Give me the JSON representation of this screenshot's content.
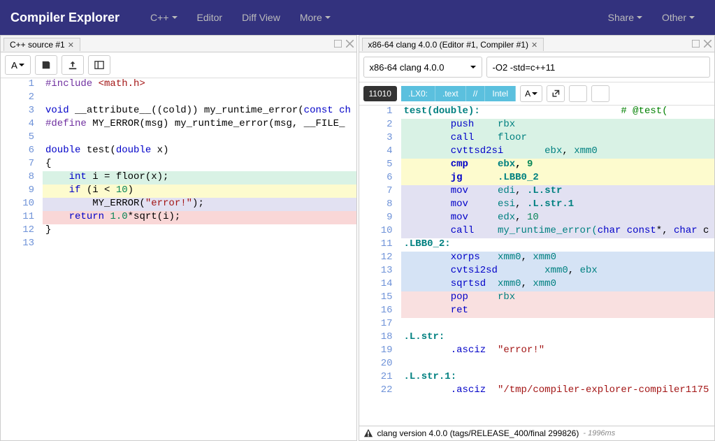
{
  "navbar": {
    "brand": "Compiler Explorer",
    "items": [
      "C++",
      "Editor",
      "Diff View",
      "More"
    ],
    "right": [
      "Share",
      "Other"
    ]
  },
  "left": {
    "tab": "C++ source #1",
    "fontBtn": "A",
    "lines": [
      {
        "n": 1,
        "bg": "",
        "tokens": [
          {
            "t": "#include ",
            "c": "mac"
          },
          {
            "t": "<math.h>",
            "c": "str"
          }
        ]
      },
      {
        "n": 2,
        "bg": "",
        "tokens": []
      },
      {
        "n": 3,
        "bg": "",
        "tokens": [
          {
            "t": "void",
            "c": "kw"
          },
          {
            "t": " __attribute__((",
            "c": ""
          },
          {
            "t": "cold",
            "c": ""
          },
          {
            "t": ")) my_runtime_error(",
            "c": ""
          },
          {
            "t": "const",
            "c": "kw"
          },
          {
            "t": " ",
            "c": ""
          },
          {
            "t": "ch",
            "c": "kw"
          }
        ]
      },
      {
        "n": 4,
        "bg": "",
        "tokens": [
          {
            "t": "#define",
            "c": "mac"
          },
          {
            "t": " MY_ERROR(msg) my_runtime_error(msg, __FILE_",
            "c": ""
          }
        ]
      },
      {
        "n": 5,
        "bg": "",
        "tokens": []
      },
      {
        "n": 6,
        "bg": "",
        "tokens": [
          {
            "t": "double",
            "c": "kw"
          },
          {
            "t": " test(",
            "c": ""
          },
          {
            "t": "double",
            "c": "kw"
          },
          {
            "t": " x)",
            "c": ""
          }
        ]
      },
      {
        "n": 7,
        "bg": "",
        "tokens": [
          {
            "t": "{",
            "c": ""
          }
        ]
      },
      {
        "n": 8,
        "bg": "hl-green",
        "tokens": [
          {
            "t": "    ",
            "c": ""
          },
          {
            "t": "int",
            "c": "kw"
          },
          {
            "t": " i = floor(x);",
            "c": ""
          }
        ]
      },
      {
        "n": 9,
        "bg": "hl-yellow",
        "tokens": [
          {
            "t": "    ",
            "c": ""
          },
          {
            "t": "if",
            "c": "kw"
          },
          {
            "t": " (i < ",
            "c": ""
          },
          {
            "t": "10",
            "c": "num"
          },
          {
            "t": ")",
            "c": ""
          }
        ]
      },
      {
        "n": 10,
        "bg": "hl-purple",
        "tokens": [
          {
            "t": "        MY_ERROR(",
            "c": ""
          },
          {
            "t": "\"error!\"",
            "c": "str"
          },
          {
            "t": ");",
            "c": ""
          }
        ]
      },
      {
        "n": 11,
        "bg": "hl-red",
        "tokens": [
          {
            "t": "    ",
            "c": ""
          },
          {
            "t": "return",
            "c": "kw"
          },
          {
            "t": " ",
            "c": ""
          },
          {
            "t": "1.0",
            "c": "num"
          },
          {
            "t": "*sqrt(i);",
            "c": ""
          }
        ]
      },
      {
        "n": 12,
        "bg": "",
        "tokens": [
          {
            "t": "}",
            "c": ""
          }
        ]
      },
      {
        "n": 13,
        "bg": "",
        "tokens": []
      }
    ]
  },
  "right": {
    "tab": "x86-64 clang 4.0.0 (Editor #1, Compiler #1)",
    "compiler": "x86-64 clang 4.0.0",
    "flags": "-O2 -std=c++11",
    "binary": "11010",
    "segs": [
      ".LX0:",
      ".text",
      "//",
      "Intel"
    ],
    "fontBtn": "A",
    "lines": [
      {
        "n": 1,
        "bg": "",
        "tokens": [
          {
            "t": "test(double):",
            "c": "label"
          },
          {
            "t": "                        ",
            "c": ""
          },
          {
            "t": "# @test(",
            "c": "cmt"
          }
        ]
      },
      {
        "n": 2,
        "bg": "hl-green",
        "tokens": [
          {
            "t": "        ",
            "c": ""
          },
          {
            "t": "push",
            "c": "kw"
          },
          {
            "t": "    ",
            "c": ""
          },
          {
            "t": "rbx",
            "c": "reg"
          }
        ]
      },
      {
        "n": 3,
        "bg": "hl-green",
        "tokens": [
          {
            "t": "        ",
            "c": ""
          },
          {
            "t": "call",
            "c": "kw"
          },
          {
            "t": "    ",
            "c": ""
          },
          {
            "t": "floor",
            "c": "reg"
          }
        ]
      },
      {
        "n": 4,
        "bg": "hl-green",
        "tokens": [
          {
            "t": "        ",
            "c": ""
          },
          {
            "t": "cvttsd2si",
            "c": "kw"
          },
          {
            "t": "       ",
            "c": ""
          },
          {
            "t": "ebx",
            "c": "reg"
          },
          {
            "t": ", ",
            "c": ""
          },
          {
            "t": "xmm0",
            "c": "reg"
          }
        ]
      },
      {
        "n": 5,
        "bg": "hl-yellow",
        "tokens": [
          {
            "t": "        ",
            "c": ""
          },
          {
            "t": "cmp",
            "c": "kw bold"
          },
          {
            "t": "     ",
            "c": ""
          },
          {
            "t": "ebx",
            "c": "reg bold"
          },
          {
            "t": ", ",
            "c": "bold"
          },
          {
            "t": "9",
            "c": "num bold"
          }
        ]
      },
      {
        "n": 6,
        "bg": "hl-yellow",
        "tokens": [
          {
            "t": "        ",
            "c": ""
          },
          {
            "t": "jg",
            "c": "kw bold"
          },
          {
            "t": "      ",
            "c": ""
          },
          {
            "t": ".LBB0_2",
            "c": "label bold"
          }
        ]
      },
      {
        "n": 7,
        "bg": "hl-purple",
        "tokens": [
          {
            "t": "        ",
            "c": ""
          },
          {
            "t": "mov",
            "c": "kw"
          },
          {
            "t": "     ",
            "c": ""
          },
          {
            "t": "edi",
            "c": "reg"
          },
          {
            "t": ", ",
            "c": ""
          },
          {
            "t": ".L.str",
            "c": "label"
          }
        ]
      },
      {
        "n": 8,
        "bg": "hl-purple",
        "tokens": [
          {
            "t": "        ",
            "c": ""
          },
          {
            "t": "mov",
            "c": "kw"
          },
          {
            "t": "     ",
            "c": ""
          },
          {
            "t": "esi",
            "c": "reg"
          },
          {
            "t": ", ",
            "c": ""
          },
          {
            "t": ".L.str.1",
            "c": "label"
          }
        ]
      },
      {
        "n": 9,
        "bg": "hl-purple",
        "tokens": [
          {
            "t": "        ",
            "c": ""
          },
          {
            "t": "mov",
            "c": "kw"
          },
          {
            "t": "     ",
            "c": ""
          },
          {
            "t": "edx",
            "c": "reg"
          },
          {
            "t": ", ",
            "c": ""
          },
          {
            "t": "10",
            "c": "num"
          }
        ]
      },
      {
        "n": 10,
        "bg": "hl-purple",
        "tokens": [
          {
            "t": "        ",
            "c": ""
          },
          {
            "t": "call",
            "c": "kw"
          },
          {
            "t": "    ",
            "c": ""
          },
          {
            "t": "my_runtime_error(",
            "c": "reg"
          },
          {
            "t": "char",
            "c": "kw"
          },
          {
            "t": " ",
            "c": ""
          },
          {
            "t": "const",
            "c": "kw"
          },
          {
            "t": "*, ",
            "c": ""
          },
          {
            "t": "char",
            "c": "kw"
          },
          {
            "t": " c",
            "c": ""
          }
        ]
      },
      {
        "n": 11,
        "bg": "",
        "tokens": [
          {
            "t": ".LBB0_2:",
            "c": "label"
          }
        ]
      },
      {
        "n": 12,
        "bg": "hl-blue",
        "tokens": [
          {
            "t": "        ",
            "c": ""
          },
          {
            "t": "xorps",
            "c": "kw"
          },
          {
            "t": "   ",
            "c": ""
          },
          {
            "t": "xmm0",
            "c": "reg"
          },
          {
            "t": ", ",
            "c": ""
          },
          {
            "t": "xmm0",
            "c": "reg"
          }
        ]
      },
      {
        "n": 13,
        "bg": "hl-blue",
        "tokens": [
          {
            "t": "        ",
            "c": ""
          },
          {
            "t": "cvtsi2sd",
            "c": "kw"
          },
          {
            "t": "        ",
            "c": ""
          },
          {
            "t": "xmm0",
            "c": "reg"
          },
          {
            "t": ", ",
            "c": ""
          },
          {
            "t": "ebx",
            "c": "reg"
          }
        ]
      },
      {
        "n": 14,
        "bg": "hl-blue",
        "tokens": [
          {
            "t": "        ",
            "c": ""
          },
          {
            "t": "sqrtsd",
            "c": "kw"
          },
          {
            "t": "  ",
            "c": ""
          },
          {
            "t": "xmm0",
            "c": "reg"
          },
          {
            "t": ", ",
            "c": ""
          },
          {
            "t": "xmm0",
            "c": "reg"
          }
        ]
      },
      {
        "n": 15,
        "bg": "hl-pink",
        "tokens": [
          {
            "t": "        ",
            "c": ""
          },
          {
            "t": "pop",
            "c": "kw"
          },
          {
            "t": "     ",
            "c": ""
          },
          {
            "t": "rbx",
            "c": "reg"
          }
        ]
      },
      {
        "n": 16,
        "bg": "hl-pink",
        "tokens": [
          {
            "t": "        ",
            "c": ""
          },
          {
            "t": "ret",
            "c": "kw"
          }
        ]
      },
      {
        "n": 17,
        "bg": "",
        "tokens": []
      },
      {
        "n": 18,
        "bg": "",
        "tokens": [
          {
            "t": ".L.str:",
            "c": "label"
          }
        ]
      },
      {
        "n": 19,
        "bg": "",
        "tokens": [
          {
            "t": "        ",
            "c": ""
          },
          {
            "t": ".asciz",
            "c": "kw"
          },
          {
            "t": "  ",
            "c": ""
          },
          {
            "t": "\"error!\"",
            "c": "str"
          }
        ]
      },
      {
        "n": 20,
        "bg": "",
        "tokens": []
      },
      {
        "n": 21,
        "bg": "",
        "tokens": [
          {
            "t": ".L.str.1:",
            "c": "label"
          }
        ]
      },
      {
        "n": 22,
        "bg": "",
        "tokens": [
          {
            "t": "        ",
            "c": ""
          },
          {
            "t": ".asciz",
            "c": "kw"
          },
          {
            "t": "  ",
            "c": ""
          },
          {
            "t": "\"/tmp/compiler-explorer-compiler1175",
            "c": "str"
          }
        ]
      }
    ],
    "status": "clang version 4.0.0 (tags/RELEASE_400/final 299826)",
    "time": "- 1996ms"
  }
}
